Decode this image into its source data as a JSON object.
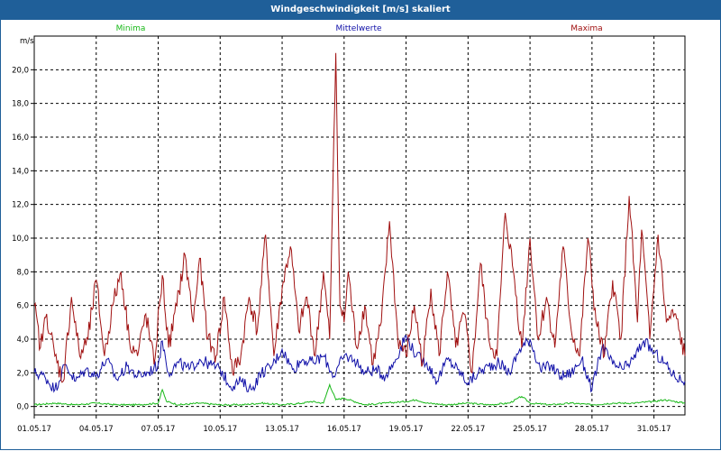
{
  "window": {
    "title": "Windgeschwindigkeit [m/s] skaliert"
  },
  "chart_data": {
    "type": "line",
    "title": "Windgeschwindigkeit [m/s] skaliert",
    "ylabel": "m/s",
    "ylim": [
      -0.5,
      22.0
    ],
    "y_ticks": [
      0.0,
      2.0,
      4.0,
      6.0,
      8.0,
      10.0,
      12.0,
      14.0,
      16.0,
      18.0,
      20.0
    ],
    "y_tick_labels": [
      "0,0",
      "2,0",
      "4,0",
      "6,0",
      "8,0",
      "10,0",
      "12,0",
      "14,0",
      "16,0",
      "18,0",
      "20,0"
    ],
    "x_range_days": [
      0,
      31.5
    ],
    "x_ticks": [
      {
        "day": 0,
        "label": "01.05.17"
      },
      {
        "day": 3,
        "label": "04.05.17"
      },
      {
        "day": 6,
        "label": "07.05.17"
      },
      {
        "day": 9,
        "label": "10.05.17"
      },
      {
        "day": 12,
        "label": "13.05.17"
      },
      {
        "day": 15,
        "label": "16.05.17"
      },
      {
        "day": 18,
        "label": "19.05.17"
      },
      {
        "day": 21,
        "label": "22.05.17"
      },
      {
        "day": 24,
        "label": "25.05.17"
      },
      {
        "day": 27,
        "label": "28.05.17"
      },
      {
        "day": 30,
        "label": "31.05.17"
      }
    ],
    "grid": true,
    "legend_position": "top",
    "series": [
      {
        "name": "Minima",
        "color": "#18b818",
        "x": [
          0,
          1,
          2,
          3,
          4,
          5,
          6,
          6.2,
          6.4,
          7,
          8,
          9,
          10,
          11,
          12,
          13,
          13.4,
          14,
          14.3,
          14.6,
          15,
          16,
          17,
          18,
          18.5,
          19,
          20,
          21,
          22,
          23,
          23.6,
          24,
          25,
          26,
          27,
          28,
          29,
          30,
          30.5,
          31,
          31.5
        ],
        "values": [
          0.1,
          0.2,
          0.1,
          0.2,
          0.1,
          0.1,
          0.2,
          1.0,
          0.3,
          0.1,
          0.2,
          0.1,
          0.1,
          0.2,
          0.1,
          0.2,
          0.3,
          0.2,
          1.3,
          0.4,
          0.5,
          0.1,
          0.2,
          0.3,
          0.4,
          0.2,
          0.1,
          0.2,
          0.1,
          0.2,
          0.6,
          0.2,
          0.1,
          0.2,
          0.1,
          0.2,
          0.2,
          0.3,
          0.4,
          0.3,
          0.2
        ]
      },
      {
        "name": "Mittelwerte",
        "color": "#1010a8",
        "x": [
          0,
          0.5,
          1,
          1.5,
          2,
          2.5,
          3,
          3.5,
          4,
          4.5,
          5,
          5.5,
          6,
          6.2,
          6.5,
          7,
          7.5,
          8,
          8.5,
          9,
          9.5,
          10,
          10.5,
          11,
          11.5,
          12,
          12.5,
          13,
          13.5,
          14,
          14.5,
          15,
          15.5,
          16,
          16.5,
          17,
          17.5,
          18,
          18.5,
          19,
          19.5,
          20,
          20.5,
          21,
          21.5,
          22,
          22.5,
          23,
          23.5,
          24,
          24.5,
          25,
          25.5,
          26,
          26.5,
          27,
          27.5,
          28,
          28.5,
          29,
          29.5,
          30,
          30.5,
          31,
          31.5
        ],
        "values": [
          2.0,
          1.8,
          1.0,
          2.5,
          1.5,
          2.2,
          1.8,
          2.8,
          1.6,
          2.4,
          1.8,
          2.0,
          2.5,
          3.9,
          2.0,
          2.6,
          2.2,
          2.8,
          2.5,
          2.2,
          1.2,
          1.5,
          1.0,
          2.0,
          2.4,
          3.4,
          2.2,
          2.8,
          2.6,
          3.0,
          1.8,
          3.0,
          2.8,
          2.0,
          2.2,
          1.8,
          2.8,
          4.2,
          3.0,
          2.6,
          1.5,
          2.8,
          2.2,
          1.4,
          2.0,
          2.4,
          2.6,
          2.0,
          3.4,
          4.0,
          2.2,
          2.4,
          1.8,
          2.0,
          2.8,
          1.0,
          3.6,
          2.5,
          2.2,
          2.8,
          3.9,
          3.2,
          2.6,
          1.8,
          1.5
        ]
      },
      {
        "name": "Maxima",
        "color": "#a01010",
        "x": [
          0,
          0.3,
          0.6,
          1,
          1.4,
          1.8,
          2.2,
          2.6,
          3,
          3.4,
          3.8,
          4.2,
          4.6,
          5,
          5.4,
          5.8,
          6.2,
          6.5,
          6.9,
          7.3,
          7.7,
          8,
          8.4,
          8.8,
          9.2,
          9.6,
          10,
          10.4,
          10.8,
          11.2,
          11.6,
          12,
          12.4,
          12.8,
          13.2,
          13.6,
          14,
          14.3,
          14.6,
          14.8,
          15,
          15.2,
          15.6,
          16,
          16.4,
          16.8,
          17.2,
          17.6,
          18,
          18.4,
          18.8,
          19.2,
          19.6,
          20,
          20.4,
          20.8,
          21.2,
          21.6,
          22,
          22.4,
          22.8,
          23.2,
          23.6,
          24,
          24.4,
          24.8,
          25.2,
          25.6,
          26,
          26.4,
          26.8,
          27.2,
          27.6,
          28,
          28.4,
          28.8,
          29.2,
          29.4,
          29.8,
          30.2,
          30.6,
          31,
          31.5
        ],
        "values": [
          6.0,
          3.5,
          5.5,
          3.0,
          1.5,
          6.5,
          3.0,
          4.0,
          7.5,
          3.0,
          6.0,
          8.0,
          4.0,
          3.0,
          5.5,
          2.5,
          7.8,
          3.5,
          6.0,
          9.0,
          5.0,
          8.8,
          4.0,
          3.0,
          6.5,
          2.0,
          3.0,
          6.5,
          4.5,
          10.2,
          3.0,
          7.0,
          9.5,
          4.5,
          6.5,
          3.0,
          8.0,
          4.0,
          21.0,
          6.0,
          5.0,
          8.0,
          3.5,
          6.0,
          2.5,
          5.0,
          11.0,
          4.0,
          3.0,
          6.0,
          2.5,
          7.0,
          3.0,
          8.0,
          3.5,
          5.5,
          2.0,
          8.5,
          4.0,
          3.0,
          11.5,
          8.0,
          3.5,
          10.0,
          4.0,
          6.5,
          3.5,
          9.5,
          4.5,
          3.0,
          10.0,
          5.0,
          3.0,
          7.5,
          4.0,
          12.5,
          5.0,
          10.5,
          4.0,
          10.2,
          5.0,
          5.5,
          3.0
        ]
      }
    ]
  }
}
